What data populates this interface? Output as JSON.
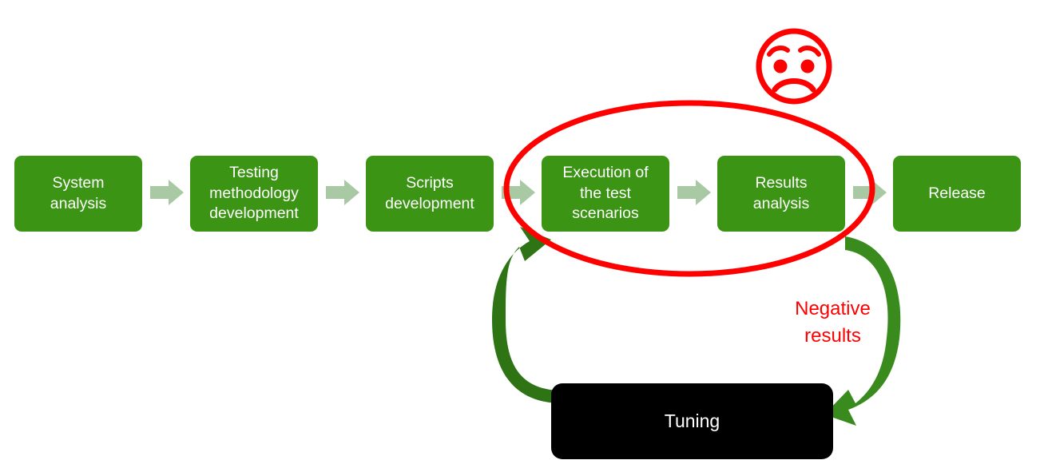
{
  "diagram": {
    "title": "Testing process flow with tuning feedback loop",
    "background_color": "#FFFFFF",
    "colors": {
      "stage_fill": "#3C9415",
      "stage_text": "#FFFFFF",
      "connector_arrow": "#A9C9A4",
      "highlight_ellipse": "#FF0000",
      "loop_arrow": "#3A8B1E",
      "loop_arrow_dark": "#2E7314",
      "tuning_fill": "#000000",
      "tuning_text": "#FFFFFF",
      "negative_text": "#FF0000"
    }
  },
  "stages": [
    {
      "id": "system-analysis",
      "label": "System\nanalysis"
    },
    {
      "id": "testing-methodology-development",
      "label": "Testing\nmethodology\ndevelopment"
    },
    {
      "id": "scripts-development",
      "label": "Scripts\ndevelopment"
    },
    {
      "id": "execution-of-the-test-scenarios",
      "label": "Execution of\nthe test\nscenarios"
    },
    {
      "id": "results-analysis",
      "label": "Results\nanalysis"
    },
    {
      "id": "release",
      "label": "Release"
    }
  ],
  "feedback": {
    "tuning_label": "Tuning",
    "negative_results_label": "Negative\nresults",
    "sad_face_icon": "sad-face-icon",
    "highlight_icon": "red-ellipse-highlight"
  }
}
